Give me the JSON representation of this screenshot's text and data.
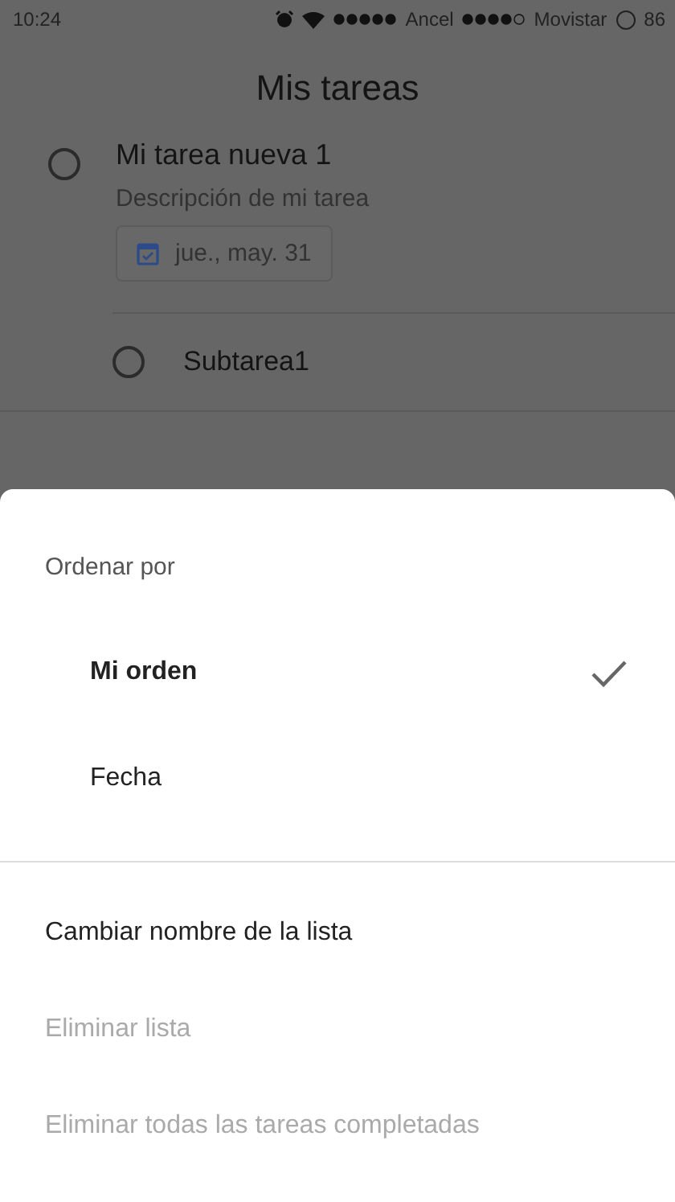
{
  "status_bar": {
    "time": "10:24",
    "carriers": [
      "Ancel",
      "Movistar"
    ],
    "battery": "86"
  },
  "title": "Mis tareas",
  "task": {
    "title": "Mi tarea nueva 1",
    "description": "Descripción de mi tarea",
    "date": "jue., may. 31",
    "checked": false,
    "subtasks": [
      {
        "title": "Subtarea1",
        "checked": false
      }
    ]
  },
  "sheet": {
    "heading": "Ordenar por",
    "options": [
      {
        "label": "Mi orden",
        "selected": true
      },
      {
        "label": "Fecha",
        "selected": false
      }
    ],
    "actions": [
      {
        "label": "Cambiar nombre de la lista",
        "disabled": false
      },
      {
        "label": "Eliminar lista",
        "disabled": true
      },
      {
        "label": "Eliminar todas las tareas completadas",
        "disabled": true
      }
    ]
  }
}
